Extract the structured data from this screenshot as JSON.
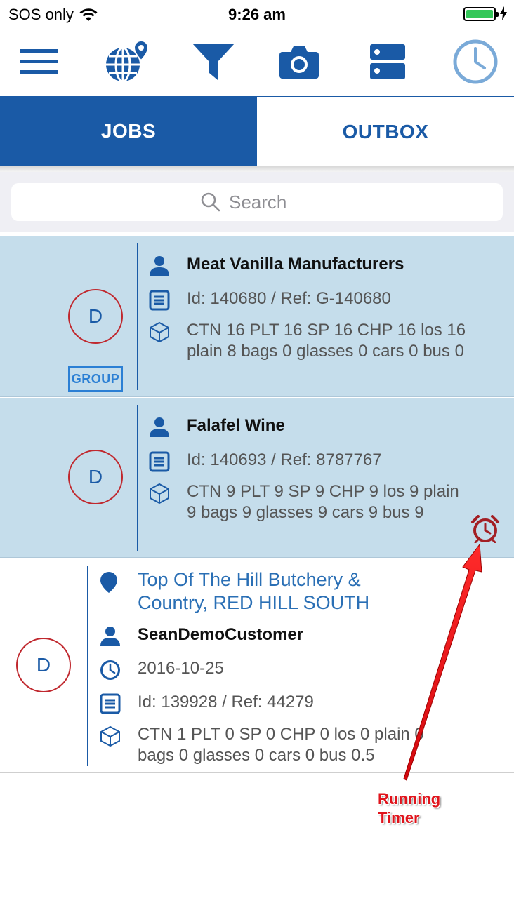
{
  "status_bar": {
    "carrier": "SOS only",
    "time": "9:26 am",
    "wifi_icon": "wifi-icon",
    "battery_icon": "battery-charging-icon"
  },
  "toolbar": {
    "icons": [
      "menu-icon",
      "globe-location-icon",
      "filter-icon",
      "camera-icon",
      "server-icon",
      "clock-icon"
    ]
  },
  "tabs": [
    {
      "label": "JOBS",
      "active": true
    },
    {
      "label": "OUTBOX",
      "active": false
    }
  ],
  "search": {
    "placeholder": "Search"
  },
  "jobs": [
    {
      "badge": "D",
      "group_label": "GROUP",
      "customer": "Meat Vanilla Manufacturers",
      "id_ref": "Id: 140680 / Ref: G-140680",
      "items": "CTN 16 PLT 16 SP 16 CHP 16 los 16 plain 8 bags 0 glasses 0 cars 0 bus 0"
    },
    {
      "badge": "D",
      "customer": "Falafel Wine",
      "id_ref": "Id: 140693 / Ref: 8787767",
      "items": "CTN 9 PLT 9 SP 9 CHP 9 los 9 plain 9 bags 9 glasses 9 cars 9 bus 9",
      "timer_icon": "alarm-clock-icon"
    },
    {
      "badge": "D",
      "address": "Top Of The Hill Butchery & Country, RED HILL SOUTH",
      "customer": "SeanDemoCustomer",
      "date": "2016-10-25",
      "id_ref": "Id: 139928 / Ref: 44279",
      "items": "CTN 1 PLT 0 SP 0 CHP 0 los 0 plain 0 bags 0 glasses 0 cars 0 bus 0.5"
    }
  ],
  "annotation": {
    "line1": "Running",
    "line2": "Timer"
  },
  "colors": {
    "brand_blue": "#1a5aa6",
    "badge_red": "#c0282e",
    "selected_row": "#c5ddeb",
    "timer_red": "#a31f24",
    "annotation_red": "#e0141c"
  }
}
